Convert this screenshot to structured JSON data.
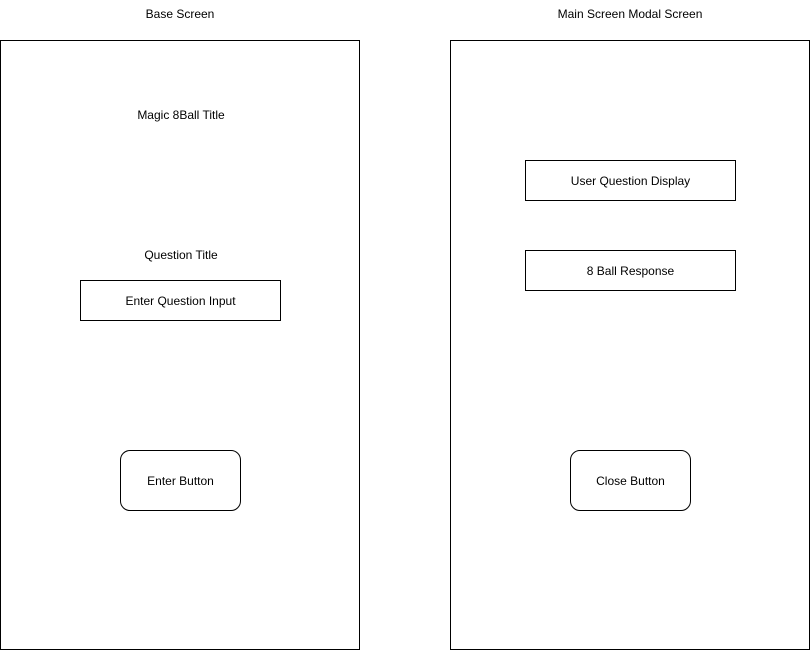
{
  "base_screen": {
    "label": "Base Screen",
    "title_text": "Magic 8Ball Title",
    "question_title": "Question Title",
    "question_input": "Enter Question Input",
    "enter_button": "Enter Button"
  },
  "modal_screen": {
    "label": "Main Screen Modal Screen",
    "user_question_display": "User Question Display",
    "ball_response": "8 Ball Response",
    "close_button": "Close Button"
  }
}
